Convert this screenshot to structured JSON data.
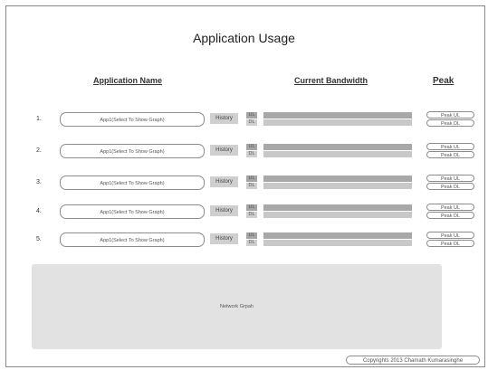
{
  "page": {
    "title": "Application Usage",
    "columns": {
      "name": "Application Name",
      "bandwidth": "Current Bandwidth",
      "peak": "Peak"
    }
  },
  "rows": [
    {
      "num": "1.",
      "app": "App1(Select To Show Graph)",
      "history": "History",
      "ul": "UL",
      "dl": "DL",
      "peak_ul": "Peak UL",
      "peak_dl": "Peak DL"
    },
    {
      "num": "2.",
      "app": "App1(Select To Show Graph)",
      "history": "History",
      "ul": "UL",
      "dl": "DL",
      "peak_ul": "Peak UL",
      "peak_dl": "Peak DL"
    },
    {
      "num": "3.",
      "app": "App1(Select To Show Graph)",
      "history": "History",
      "ul": "UL",
      "dl": "DL",
      "peak_ul": "Peak UL",
      "peak_dl": "Peak DL"
    },
    {
      "num": "4.",
      "app": "App1(Select To Show Graph)",
      "history": "History",
      "ul": "UL",
      "dl": "DL",
      "peak_ul": "Peak UL",
      "peak_dl": "Peak DL"
    },
    {
      "num": "5.",
      "app": "App1(Select To Show Graph)",
      "history": "History",
      "ul": "UL",
      "dl": "DL",
      "peak_ul": "Peak UL",
      "peak_dl": "Peak DL"
    }
  ],
  "graph": {
    "label": "Network Grpah"
  },
  "footer": {
    "copyright": "Copyrights 2013 Chamath Kumarasinghe"
  },
  "colors": {
    "ul_bar": "#a8a8a8",
    "dl_bar": "#c8c8c8",
    "graph_bg": "#e2e2e2"
  }
}
